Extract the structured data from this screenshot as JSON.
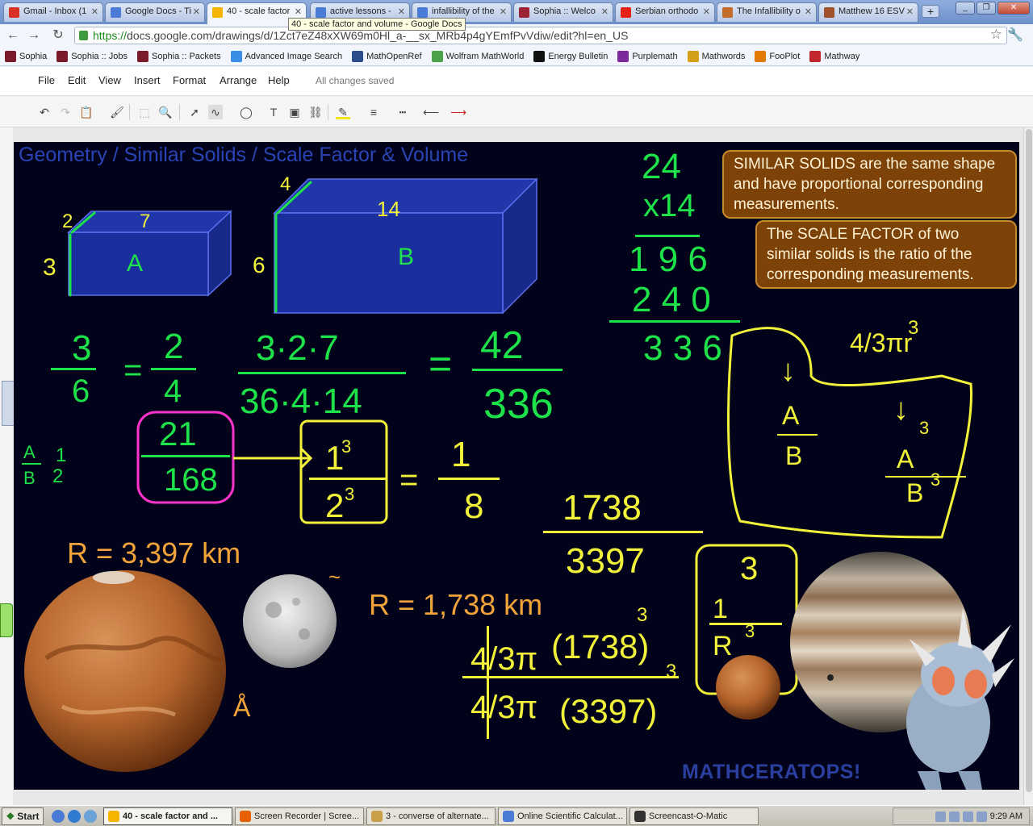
{
  "browser": {
    "tabs": [
      {
        "label": "Gmail - Inbox (1",
        "icon": "gmail-icon",
        "color": "#d93025",
        "active": false
      },
      {
        "label": "Google Docs - Ti",
        "icon": "docs-icon",
        "color": "#4a7bd6",
        "active": false
      },
      {
        "label": "40 - scale factor",
        "icon": "drawings-icon",
        "color": "#f4b400",
        "active": true
      },
      {
        "label": "active lessons -",
        "icon": "docs-icon",
        "color": "#4a7bd6",
        "active": false
      },
      {
        "label": "infallibility of the",
        "icon": "docs-icon",
        "color": "#4a7bd6",
        "active": false
      },
      {
        "label": "Sophia :: Welco",
        "icon": "sophia-icon",
        "color": "#9b2335",
        "active": false
      },
      {
        "label": "Serbian orthodo",
        "icon": "youtube-icon",
        "color": "#e62117",
        "active": false
      },
      {
        "label": "The Infallibility o",
        "icon": "page-icon",
        "color": "#c46c2a",
        "active": false
      },
      {
        "label": "Matthew 16 ESV",
        "icon": "page-icon",
        "color": "#a0522d",
        "active": false
      }
    ],
    "tooltip": "40 - scale factor and volume - Google Docs",
    "url_scheme": "https://",
    "url_rest": "docs.google.com/drawings/d/1Zct7eZ48xXW69m0Hl_a-__sx_MRb4p4gYEmfPvVdiw/edit?hl=en_US",
    "bookmarks": [
      {
        "label": "Sophia",
        "color": "#7a1a2a"
      },
      {
        "label": "Sophia :: Jobs",
        "color": "#7a1a2a"
      },
      {
        "label": "Sophia :: Packets",
        "color": "#7a1a2a"
      },
      {
        "label": "Advanced Image Search",
        "color": "#3a8ee6"
      },
      {
        "label": "MathOpenRef",
        "color": "#2b4d8c"
      },
      {
        "label": "Wolfram MathWorld",
        "color": "#4aa34a"
      },
      {
        "label": "Energy Bulletin",
        "color": "#111111"
      },
      {
        "label": "Purplemath",
        "color": "#7b2a9a"
      },
      {
        "label": "Mathwords",
        "color": "#d4a017"
      },
      {
        "label": "FooPlot",
        "color": "#e07b00"
      },
      {
        "label": "Mathway",
        "color": "#c0282d"
      }
    ]
  },
  "docs": {
    "menu": [
      "File",
      "Edit",
      "View",
      "Insert",
      "Format",
      "Arrange",
      "Help"
    ],
    "status": "All changes saved"
  },
  "slide": {
    "title": "Geometry / Similar Solids / Scale Factor & Volume",
    "callout1": "SIMILAR SOLIDS are the same shape and have proportional corresponding measurements.",
    "callout2": "The SCALE FACTOR of two similar solids is the ratio of the corresponding measurements.",
    "box_a_label": "A",
    "box_b_label": "B",
    "brand": "MATHCERATOPS!",
    "colors": {
      "background": "#02031a",
      "box_fill": "#1a2e9e",
      "ink_green": "#1ee24a",
      "ink_yellow": "#f2f23a",
      "ink_orange": "#f2a43a",
      "ink_pink": "#ff33cc"
    }
  },
  "taskbar": {
    "start": "Start",
    "tasks": [
      {
        "label": "40 - scale factor and ...",
        "color": "#f4b400",
        "active": true
      },
      {
        "label": "Screen Recorder | Scree...",
        "color": "#e66000",
        "active": false
      },
      {
        "label": "3 - converse of alternate...",
        "color": "#c8a04a",
        "active": false
      },
      {
        "label": "Online Scientific Calculat...",
        "color": "#4a7bd6",
        "active": false
      },
      {
        "label": "Screencast-O-Matic",
        "color": "#333333",
        "active": false
      }
    ],
    "clock": "9:29 AM"
  }
}
